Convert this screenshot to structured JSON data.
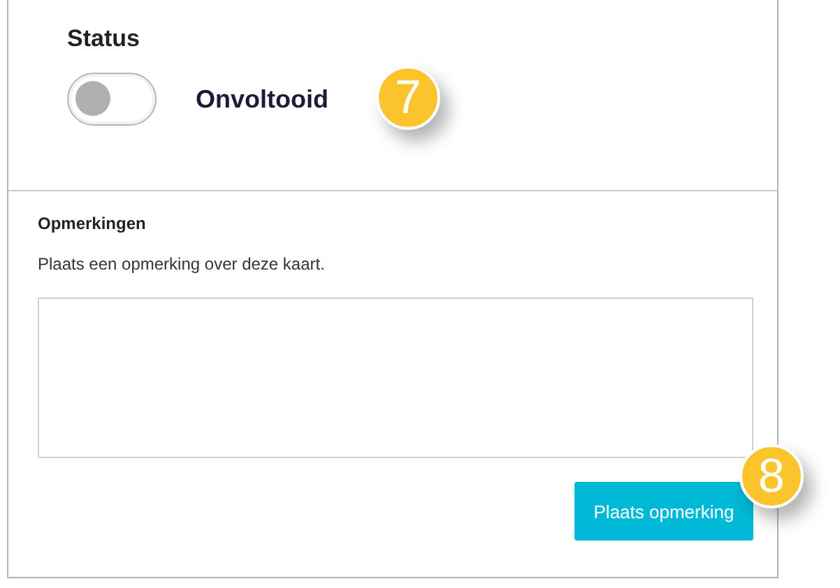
{
  "status": {
    "label": "Status",
    "toggle": {
      "on": false,
      "label": "Onvoltooid"
    },
    "badge": "7"
  },
  "comments": {
    "heading": "Opmerkingen",
    "description": "Plaats een opmerking over deze kaart.",
    "button": "Plaats opmerking",
    "badge": "8"
  }
}
